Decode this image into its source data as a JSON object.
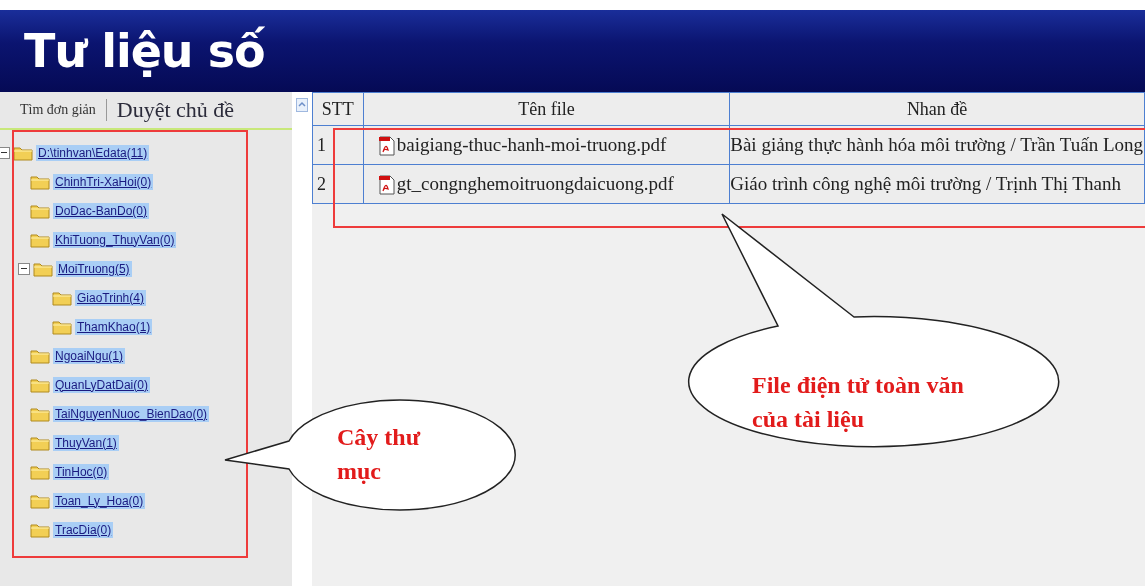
{
  "header": {
    "title": "Tư liệu số"
  },
  "left_tabs": [
    {
      "label": "Tìm đơn giản",
      "selected": false
    },
    {
      "label": "Duyệt chủ đề",
      "selected": true
    }
  ],
  "tree": [
    {
      "label": "D:\\tinhvan\\Edata(11)",
      "expanded": true,
      "children": [
        {
          "label": "ChinhTri-XaHoi(0)"
        },
        {
          "label": "DoDac-BanDo(0)"
        },
        {
          "label": "KhiTuong_ThuyVan(0)"
        },
        {
          "label": "MoiTruong(5)",
          "expanded": true,
          "children": [
            {
              "label": "GiaoTrinh(4)"
            },
            {
              "label": "ThamKhao(1)"
            }
          ]
        },
        {
          "label": "NgoaiNgu(1)"
        },
        {
          "label": "QuanLyDatDai(0)"
        },
        {
          "label": "TaiNguyenNuoc_BienDao(0)"
        },
        {
          "label": "ThuyVan(1)"
        },
        {
          "label": "TinHoc(0)"
        },
        {
          "label": "Toan_Ly_Hoa(0)"
        },
        {
          "label": "TracDia(0)"
        }
      ]
    }
  ],
  "table": {
    "columns": [
      "STT",
      "Tên file",
      "Nhan đề"
    ],
    "rows": [
      {
        "stt": "1",
        "file": "baigiang-thuc-hanh-moi-truong.pdf",
        "title": "Bài giảng thực hành hóa môi trường / Trần Tuấn Long"
      },
      {
        "stt": "2",
        "file": "gt_congnghemoitruongdaicuong.pdf",
        "title": "Giáo trình công nghệ môi trường / Trịnh Thị Thanh"
      }
    ]
  },
  "callouts": [
    {
      "text": "Cây thư mục"
    },
    {
      "text": "File điện tử toàn văn của tài liệu"
    }
  ]
}
